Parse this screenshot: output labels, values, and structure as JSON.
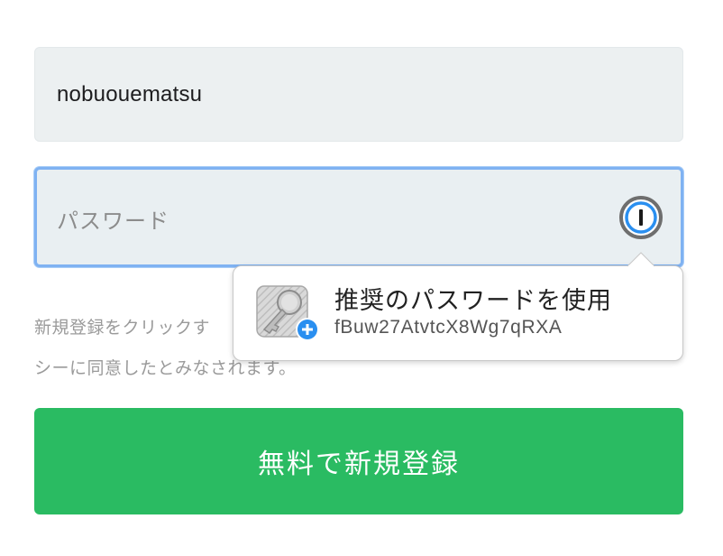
{
  "form": {
    "username_value": "nobuouematsu",
    "password_placeholder": "パスワード",
    "notice_line1": "新規登録をクリックす",
    "notice_line2": "シーに同意したとみなされます。",
    "submit_label": "無料で新規登録"
  },
  "password_manager": {
    "field_icon": "1password-icon",
    "suggestion_title": "推奨のパスワードを使用",
    "suggested_password": "fBuw27AtvtcX8Wg7qRXA",
    "suggestion_icon": "key-add-icon"
  },
  "colors": {
    "submit_bg": "#2abb62",
    "focus_ring": "#7fb2f2",
    "field_bg": "#ecf0f1",
    "add_badge": "#2a8ff0"
  }
}
